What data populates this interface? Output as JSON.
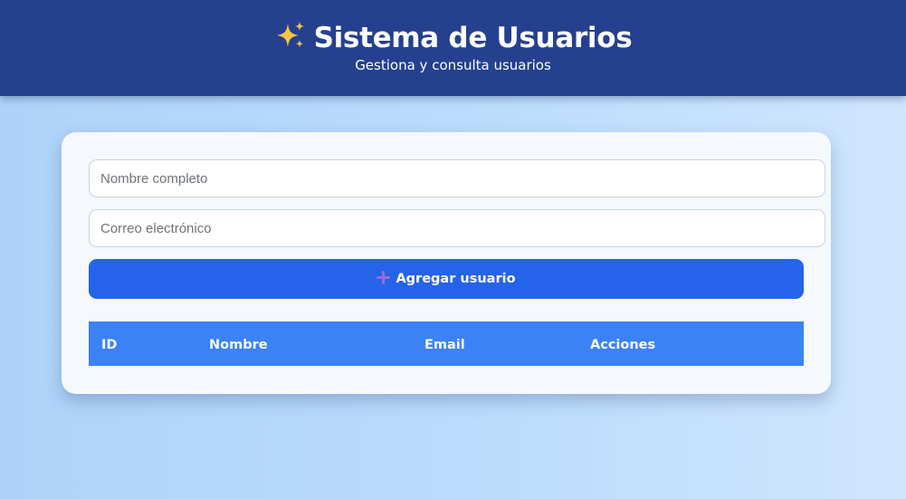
{
  "header": {
    "icon": "sparkles-icon",
    "title": "Sistema de Usuarios",
    "subtitle": "Gestiona y consulta usuarios"
  },
  "form": {
    "name_placeholder": "Nombre completo",
    "name_value": "",
    "email_placeholder": "Correo electrónico",
    "email_value": "",
    "add_button_icon": "plus-icon",
    "add_button_label": "Agregar usuario"
  },
  "table": {
    "columns": [
      "ID",
      "Nombre",
      "Email",
      "Acciones"
    ],
    "rows": []
  },
  "colors": {
    "header_bg": "#25408f",
    "primary_button": "#2563eb",
    "table_header": "#3b82f6",
    "sparkle": "#f5c542",
    "plus": "#9a6cd8"
  }
}
